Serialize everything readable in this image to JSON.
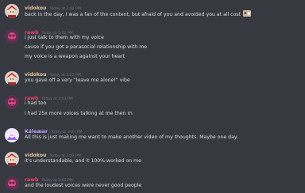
{
  "colors": {
    "background": "#36393f",
    "text": "#dcddde",
    "timestamp": "#72767d",
    "vidokou": "#e8c5a0",
    "rawb": "#f04070",
    "kaleaar": "#c0a0ff"
  },
  "messages": [
    {
      "author": "vidokou",
      "author_color": "#e8c5a0",
      "timestamp": "Today at 3:02 PM",
      "avatar_icon": "vidokou-avatar-icon",
      "lines": [
        "back in the day, I was a fan of the content, but afraid of you and avoided you at all cost"
      ],
      "emoji": "custom-emoji-icon"
    },
    {
      "author": "rawb",
      "author_color": "#f04070",
      "timestamp": "Today at 3:02 PM",
      "avatar_icon": "rawb-avatar-icon",
      "lines": [
        "i just talk to them with my voice",
        "cause if you got a parasocial relationship with me",
        "my voice is a weapon against your heart"
      ]
    },
    {
      "author": "vidokou",
      "author_color": "#e8c5a0",
      "timestamp": "Today at 3:02 PM",
      "avatar_icon": "vidokou-avatar-icon",
      "lines": [
        "you gave off a very \"leave me alone!\" vibe"
      ]
    },
    {
      "author": "rawb",
      "author_color": "#f04070",
      "timestamp": "Today at 3:03 PM",
      "avatar_icon": "rawb-avatar-icon",
      "lines": [
        "i had too",
        "i had 25x more voices talking at me then rn"
      ]
    },
    {
      "author": "Káleæar",
      "author_color": "#c0a0ff",
      "timestamp": "Today at 3:03 PM",
      "avatar_icon": "kaleaar-avatar-icon",
      "lines": [
        "All this is just making me want to make another video of my thoughts. Maybe one day."
      ]
    },
    {
      "author": "vidokou",
      "author_color": "#e8c5a0",
      "timestamp": "Today at 3:03 PM",
      "avatar_icon": "vidokou-avatar-icon",
      "lines": [
        "it's understandable, and it 100% worked on me"
      ]
    },
    {
      "author": "rawb",
      "author_color": "#f04070",
      "timestamp": "Today at 3:03 PM",
      "avatar_icon": "rawb-avatar-icon",
      "lines": [
        "and the loudest voices were never good people"
      ]
    }
  ]
}
